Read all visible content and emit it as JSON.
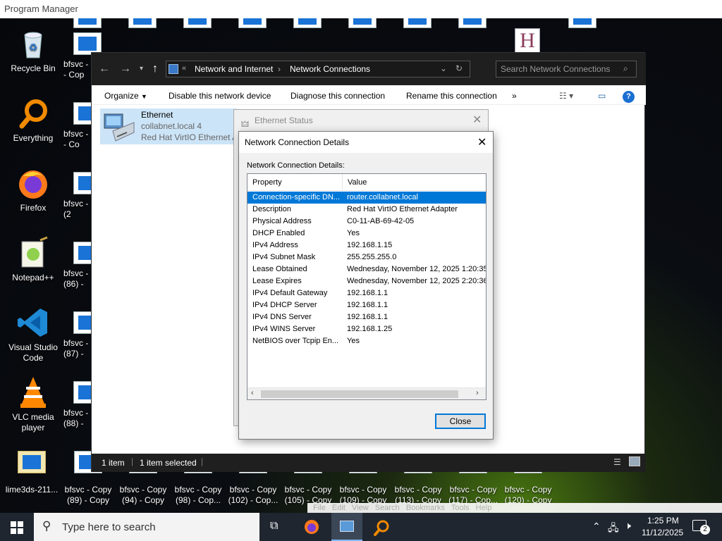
{
  "program_manager": {
    "title": "Program Manager"
  },
  "desktop": {
    "left_icons": [
      {
        "label": "Recycle Bin",
        "icon": "recycle-bin-icon"
      },
      {
        "label": "Everything",
        "icon": "everything-icon"
      },
      {
        "label": "Firefox",
        "icon": "firefox-icon"
      },
      {
        "label": "Notepad++",
        "icon": "notepadpp-icon"
      },
      {
        "label": "Visual Studio Code",
        "icon": "vscode-icon"
      },
      {
        "label": "VLC media player",
        "icon": "vlc-icon"
      }
    ],
    "column2_labels": [
      "bfsvc -\n- Cop",
      "bfsvc -\n- Co",
      "bfsvc -\n(2",
      "bfsvc -\n(86) -",
      "bfsvc -\n(87) -",
      "bfsvc -\n(88) -"
    ],
    "bottom_icons": [
      {
        "label": "lime3ds-211..."
      },
      {
        "label": "bfsvc - Copy\n(89) - Copy"
      },
      {
        "label": "bfsvc - Copy\n(94) - Copy"
      },
      {
        "label": "bfsvc - Copy\n(98) - Cop..."
      },
      {
        "label": "bfsvc - Copy\n(102) - Cop..."
      },
      {
        "label": "bfsvc - Copy\n(105) - Copy"
      },
      {
        "label": "bfsvc - Copy\n(109) - Copy"
      },
      {
        "label": "bfsvc - Copy\n(113) - Copy"
      },
      {
        "label": "bfsvc - Copy\n(117) - Cop..."
      },
      {
        "label": "bfsvc - Copy\n(120) - Copy"
      }
    ]
  },
  "explorer": {
    "breadcrumb": [
      "Network and Internet",
      "Network Connections"
    ],
    "search_placeholder": "Search Network Connections",
    "commands": [
      "Organize",
      "Disable this network device",
      "Diagnose this connection",
      "Rename this connection",
      "»"
    ],
    "item": {
      "name": "Ethernet",
      "network": "collabnet.local 4",
      "adapter": "Red Hat VirtIO Ethernet A"
    },
    "status": {
      "count": "1 item",
      "selected": "1 item selected"
    }
  },
  "ethernet_status": {
    "title": "Ethernet Status"
  },
  "details": {
    "title": "Network Connection Details",
    "group_label": "Network Connection Details:",
    "columns": [
      "Property",
      "Value"
    ],
    "rows": [
      {
        "p": "Connection-specific DN...",
        "v": "router.collabnet.local"
      },
      {
        "p": "Description",
        "v": "Red Hat VirtIO Ethernet Adapter"
      },
      {
        "p": "Physical Address",
        "v": "C0-11-AB-69-42-05"
      },
      {
        "p": "DHCP Enabled",
        "v": "Yes"
      },
      {
        "p": "IPv4 Address",
        "v": "192.168.1.15"
      },
      {
        "p": "IPv4 Subnet Mask",
        "v": "255.255.255.0"
      },
      {
        "p": "Lease Obtained",
        "v": "Wednesday, November 12, 2025 1:20:35"
      },
      {
        "p": "Lease Expires",
        "v": "Wednesday, November 12, 2025 2:20:36"
      },
      {
        "p": "IPv4 Default Gateway",
        "v": "192.168.1.1"
      },
      {
        "p": "IPv4 DHCP Server",
        "v": "192.168.1.1"
      },
      {
        "p": "IPv4 DNS Server",
        "v": "192.168.1.1"
      },
      {
        "p": "IPv4 WINS Server",
        "v": "192.168.1.25"
      },
      {
        "p": "NetBIOS over Tcpip En...",
        "v": "Yes"
      }
    ],
    "close_label": "Close"
  },
  "firefox_menu": "File   Edit   View   Search   Bookmarks   Tools   Help",
  "taskbar": {
    "search_placeholder": "Type here to search",
    "time": "1:25 PM",
    "date": "11/12/2025",
    "notif_count": "2"
  },
  "colors": {
    "accent": "#0078d7",
    "taskbar": "#1f2630",
    "selection": "#cce4f7"
  }
}
